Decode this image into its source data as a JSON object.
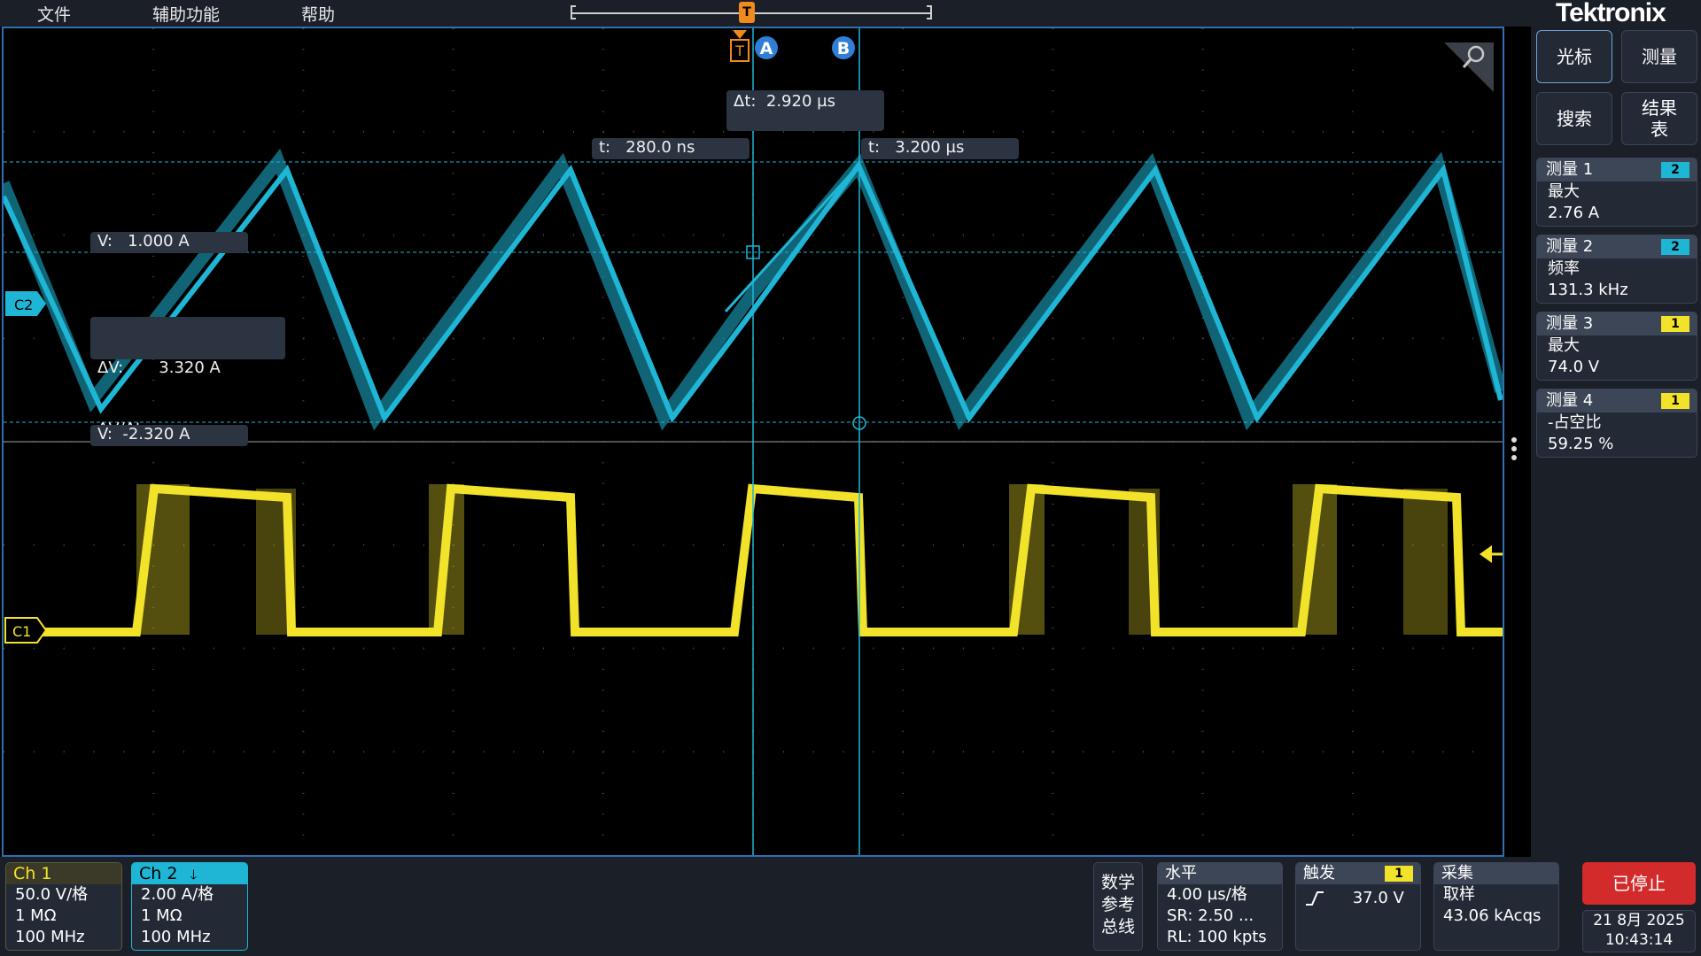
{
  "menu": {
    "file": "文件",
    "utility": "辅助功能",
    "help": "帮助"
  },
  "brand": "Tektronix",
  "trigger_marker": "T",
  "colors": {
    "ch1": "#f2e22a",
    "ch2": "#1fb6d6",
    "cursor": "#1fb6d6",
    "trigger": "#f08a1e",
    "stop": "#d32b2b"
  },
  "cursors": {
    "a_label": "A",
    "b_label": "B",
    "delta_t": "Δt:  2.920 µs",
    "ta": "t:   280.0 ns",
    "tb": "t:   3.200 µs",
    "va": "V:   1.000 A",
    "vb": "V:  -2.320 A",
    "delta_v": "ΔV:       3.320 A",
    "dvdt": "ΔV/Δt:"
  },
  "channel_markers": {
    "c1": "C1",
    "c2": "C2"
  },
  "side_buttons": {
    "cursor": "光标",
    "measure": "测量",
    "search": "搜索",
    "results_table": "结果\n表"
  },
  "measurements": [
    {
      "title": "测量 1",
      "badge": "2",
      "label": "最大",
      "value": "2.76 A"
    },
    {
      "title": "测量 2",
      "badge": "2",
      "label": "频率",
      "value": "131.3 kHz"
    },
    {
      "title": "测量 3",
      "badge": "1",
      "label": "最大",
      "value": "74.0 V"
    },
    {
      "title": "测量 4",
      "badge": "1",
      "label": "-占空比",
      "value": "59.25 %"
    }
  ],
  "ch1": {
    "title": "Ch 1",
    "scale": "50.0 V/格",
    "impedance": "1 MΩ",
    "bandwidth": "100 MHz"
  },
  "ch2": {
    "title": "Ch 2",
    "arrow": "🡓",
    "scale": "2.00 A/格",
    "impedance": "1 MΩ",
    "bandwidth": "100 MHz"
  },
  "math_ref_bus": "数学\n参考\n总线",
  "horizontal": {
    "title": "水平",
    "scale": "4.00 µs/格",
    "sr": "SR: 2.50 ...",
    "rl": "RL: 100 kpts"
  },
  "trigger": {
    "title": "触发",
    "badge": "1",
    "level": "37.0 V"
  },
  "acquisition": {
    "title": "采集",
    "mode": "取样",
    "count": "43.06 kAcqs"
  },
  "stop_label": "已停止",
  "date": "21 8月 2025",
  "time": "10:43:14"
}
